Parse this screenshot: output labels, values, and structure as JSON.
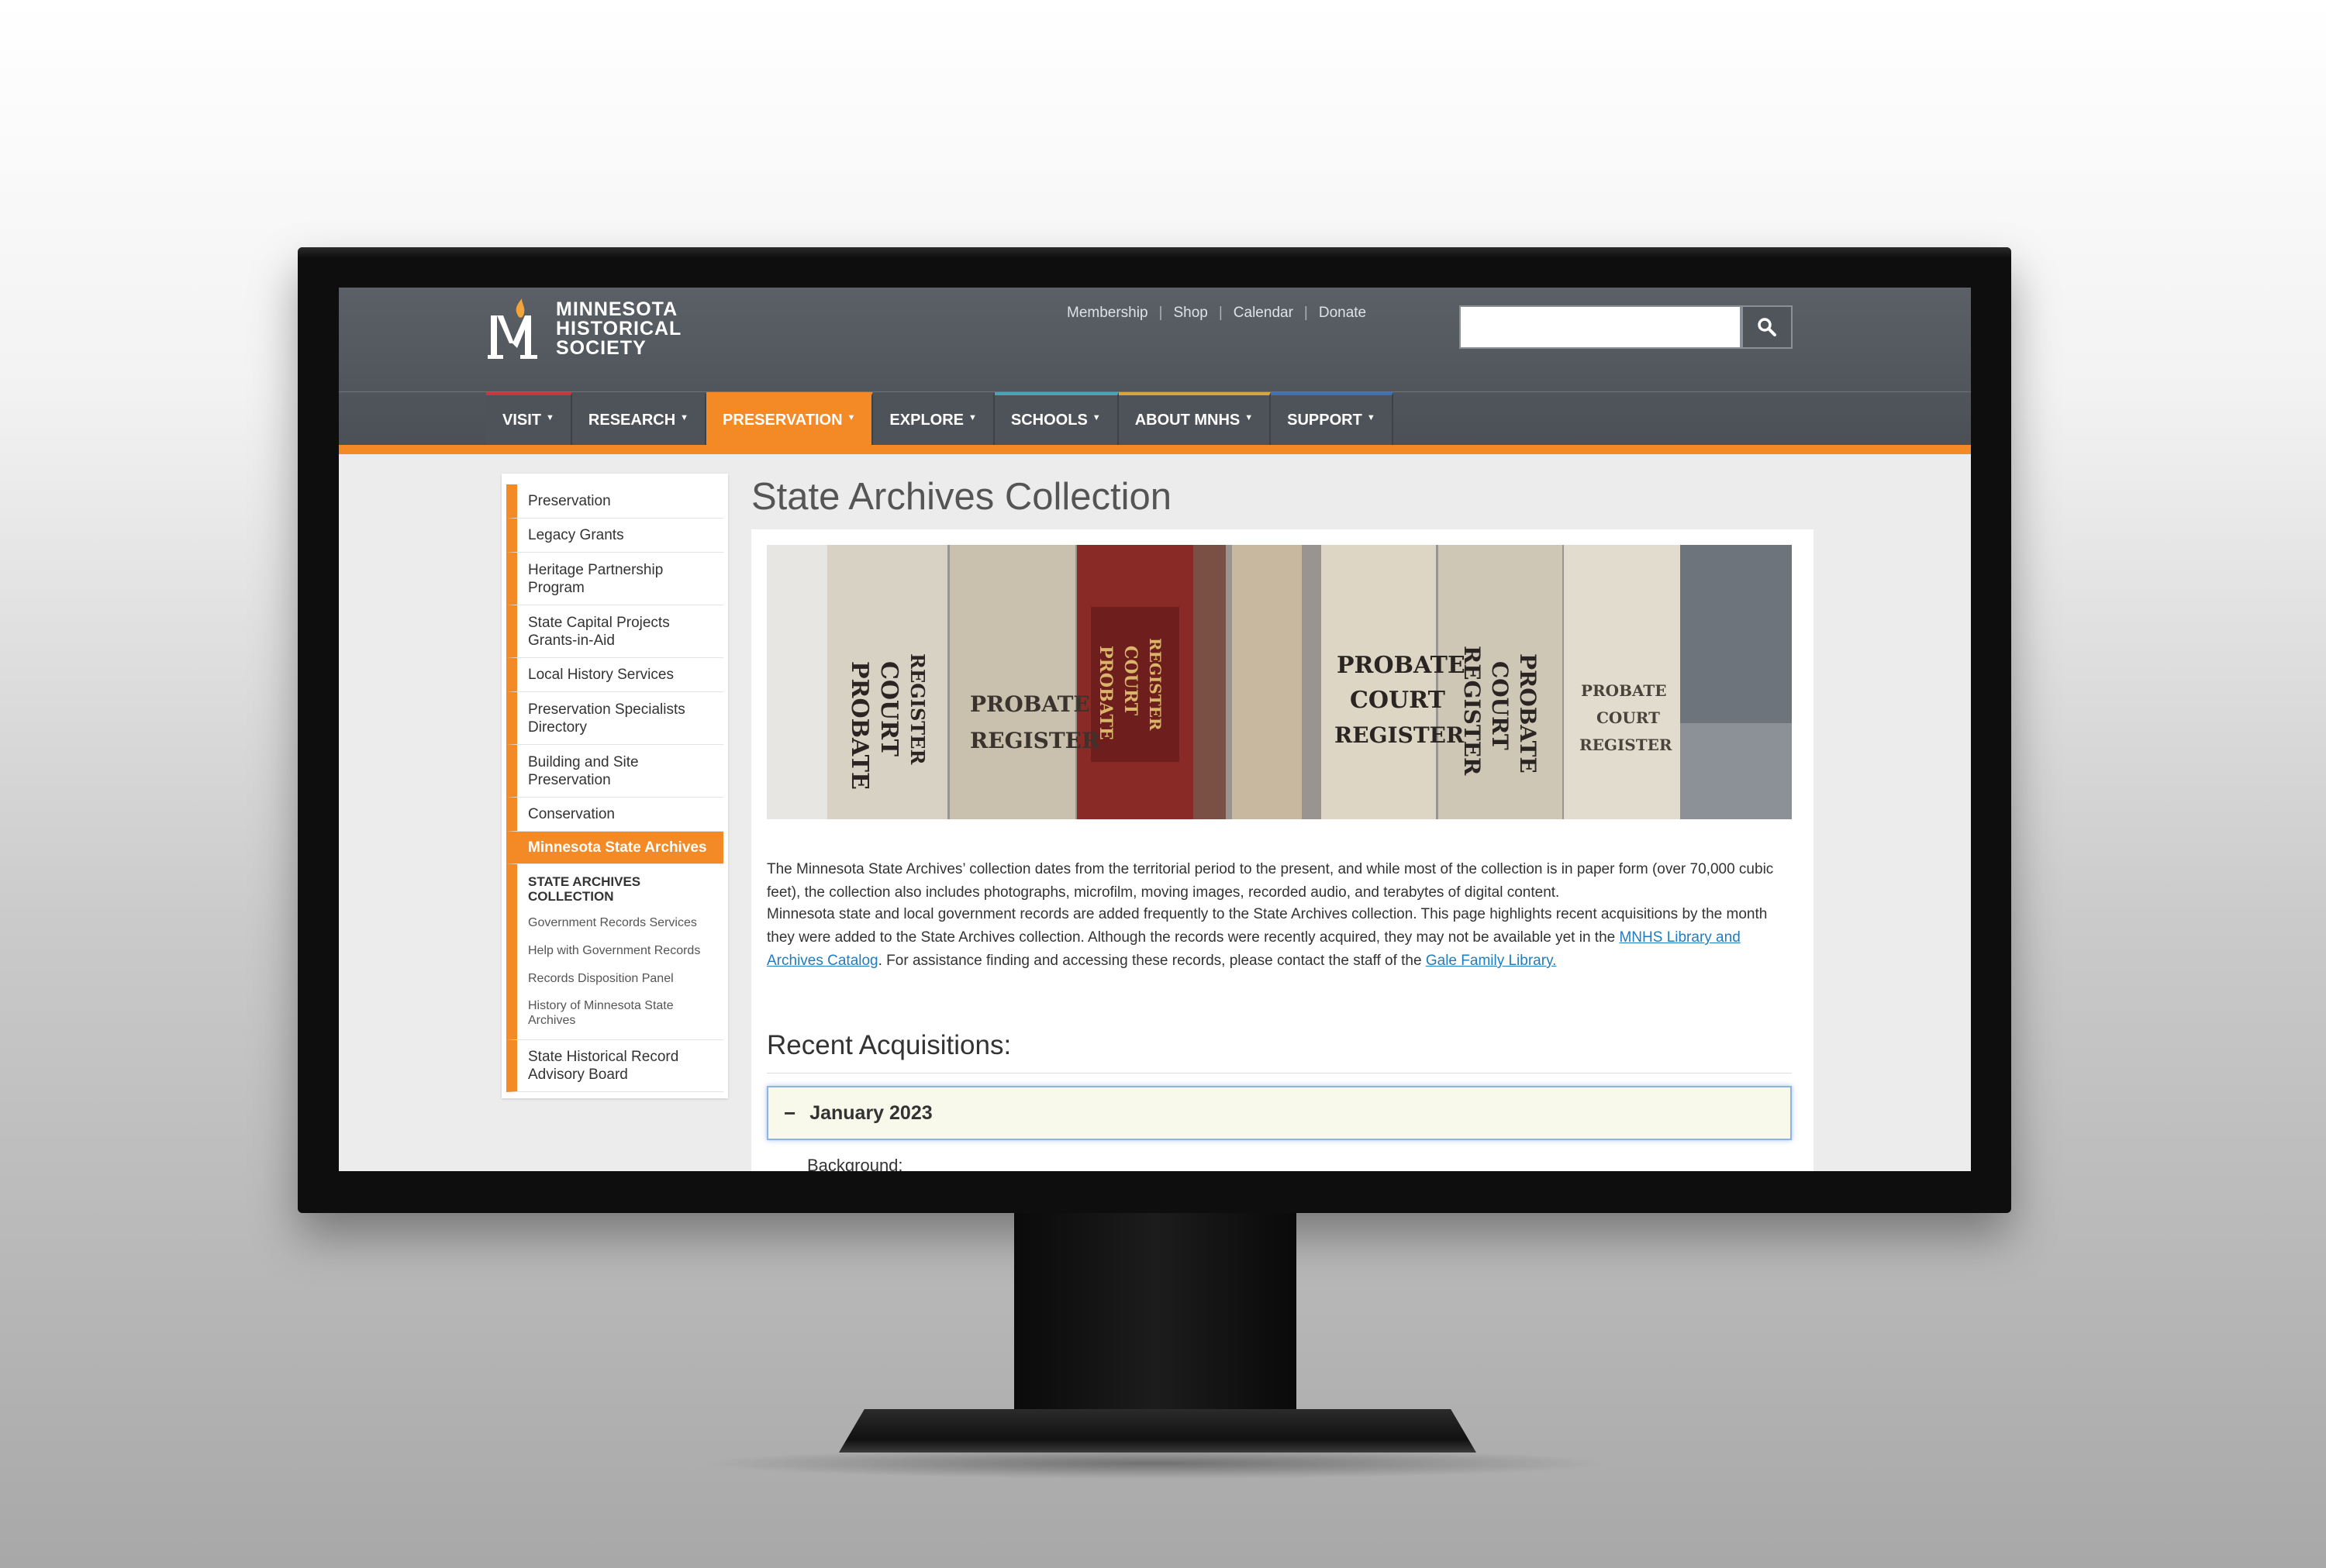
{
  "header": {
    "logo_lines": [
      "MINNESOTA",
      "HISTORICAL",
      "SOCIETY"
    ],
    "util_links": [
      "Membership",
      "Shop",
      "Calendar",
      "Donate"
    ],
    "search": {
      "value": "",
      "placeholder": ""
    }
  },
  "nav": {
    "items": [
      {
        "label": "VISIT",
        "accent": "#c8363e"
      },
      {
        "label": "RESEARCH",
        "accent": "#4e5359"
      },
      {
        "label": "PRESERVATION",
        "accent": "#f48a26"
      },
      {
        "label": "EXPLORE",
        "accent": "#4e5359"
      },
      {
        "label": "SCHOOLS",
        "accent": "#4aa3b8"
      },
      {
        "label": "ABOUT MNHS",
        "accent": "#d9a43a"
      },
      {
        "label": "SUPPORT",
        "accent": "#3f6fb5"
      }
    ],
    "active_index": 2
  },
  "sidebar": {
    "items": [
      "Preservation",
      "Legacy Grants",
      "Heritage Partnership Program",
      "State Capital Projects Grants-in-Aid",
      "Local History Services",
      "Preservation Specialists Directory",
      "Building and Site Preservation",
      "Conservation",
      "Minnesota State Archives"
    ],
    "sub_items": [
      "STATE ARCHIVES COLLECTION",
      "Government Records Services",
      "Help with Government Records",
      "Records Disposition Panel",
      "History of Minnesota State Archives"
    ],
    "last_item": "State Historical Record Advisory Board"
  },
  "page": {
    "title": "State Archives Collection",
    "para1": "The Minnesota State Archives’ collection dates from the territorial period to the present, and while most of the collection is in paper form (over 70,000 cubic feet), the collection also includes photographs, microfilm, moving images, recorded audio, and terabytes of digital content.",
    "para2_a": "Minnesota state and local government records are added frequently to the State Archives collection. This page highlights recent acquisitions by the month they were added to the State Archives collection. Although the records were recently acquired, they may not be available yet in the ",
    "para2_link1": "MNHS Library and Archives Catalog",
    "para2_b": ". For assistance finding and accessing these records, please contact the staff of the ",
    "para2_link2": "Gale Family Library.",
    "section_heading": "Recent Acquisitions:",
    "accordion_label": "January 2023",
    "accordion_peek": "Background:"
  },
  "hero_image": {
    "spine_labels": [
      [
        "PROBATE",
        "COURT",
        "REGISTER"
      ],
      [
        "PROBATE",
        "REGISTER"
      ],
      [
        "PROBATE",
        "COURT",
        "REGISTER"
      ],
      [
        "PROBATE",
        "COURT",
        "REGISTER"
      ],
      [
        "PROBATE",
        "COURT",
        "REGISTER"
      ],
      [
        "PROBATE",
        "COURT",
        "REGISTER"
      ]
    ]
  },
  "colors": {
    "accent": "#f48a26",
    "header": "#50555b",
    "link": "#1f7cc1"
  }
}
